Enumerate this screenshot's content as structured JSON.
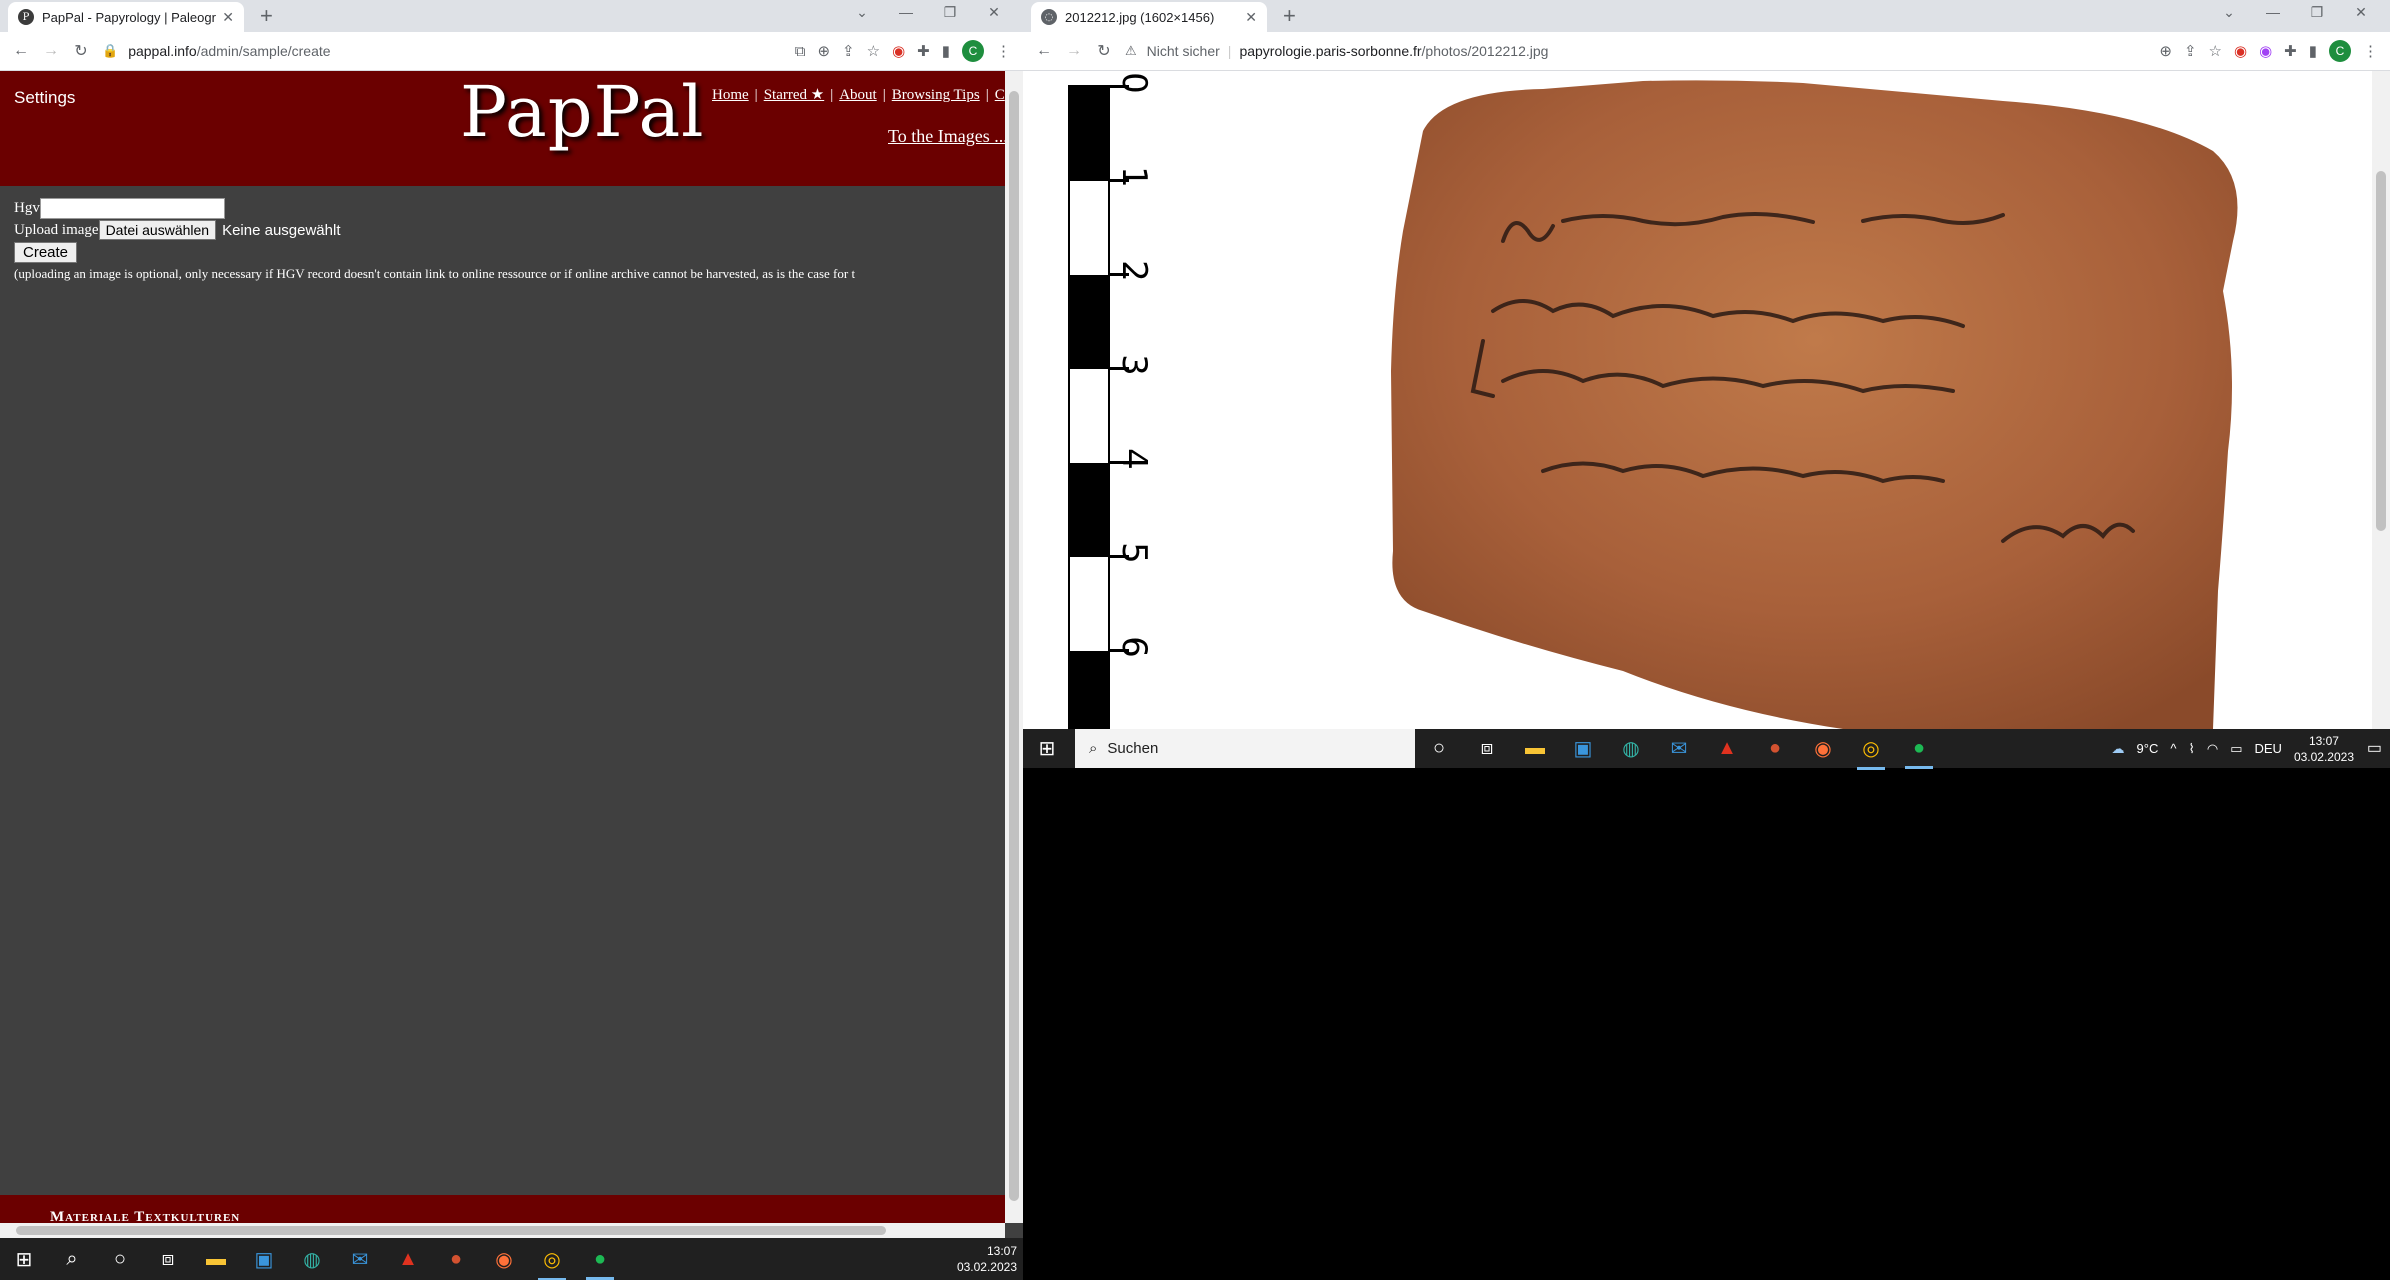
{
  "left_browser": {
    "tab_title": "PapPal - Papyrology | Paleograph",
    "url_host": "pappal.info",
    "url_path": "/admin/sample/create"
  },
  "pappal": {
    "settings": "Settings",
    "logo": "PapPal",
    "nav": [
      "Home",
      "Starred ★",
      "About",
      "Browsing Tips",
      "C"
    ],
    "to_images": "To the Images ...",
    "form": {
      "hgv_label": "Hgv",
      "hgv_value": "",
      "upload_label": "Upload image",
      "choose_file": "Datei auswählen",
      "file_status": "Keine ausgewählt",
      "create": "Create",
      "note": "(uploading an image is optional, only necessary if HGV record doesn't contain link to online ressource or if online archive cannot be harvested, as is the case for t"
    },
    "footer": "Materiale Textkulturen"
  },
  "right_browser": {
    "tab_title": "2012212.jpg (1602×1456)",
    "security": "Nicht sicher",
    "url_host": "papyrologie.paris-sorbonne.fr",
    "url_path": "/photos/2012212.jpg",
    "ruler_numbers": [
      "0",
      "1",
      "2",
      "3",
      "4",
      "5",
      "6"
    ]
  },
  "taskbar_left": {
    "time": "13:07",
    "date": "03.02.2023"
  },
  "taskbar_right": {
    "search": "Suchen",
    "weather": "9°C",
    "lang": "DEU",
    "time": "13:07",
    "date": "03.02.2023"
  },
  "avatar_letter": "C"
}
